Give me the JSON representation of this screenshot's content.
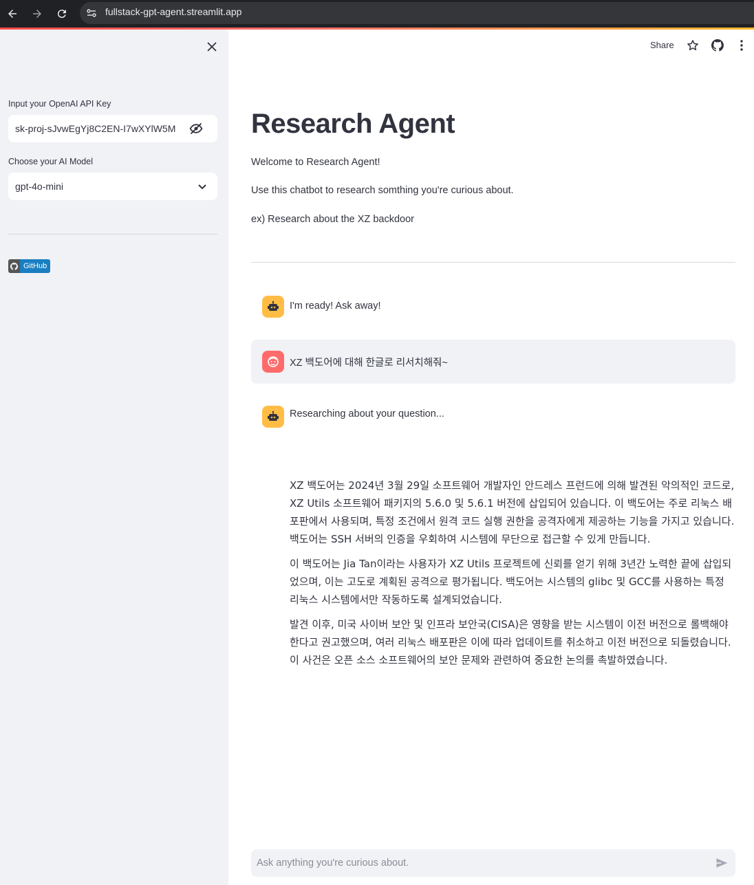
{
  "browser": {
    "url": "fullstack-gpt-agent.streamlit.app",
    "back_icon": "arrow-left-icon",
    "forward_icon": "arrow-right-icon",
    "reload_icon": "reload-icon"
  },
  "sidebar": {
    "api_key_label": "Input your OpenAI API Key",
    "api_key_value": "sk-proj-sJvwEgYj8C2EN-I7wXYlW5M",
    "model_label": "Choose your AI Model",
    "model_value": "gpt-4o-mini",
    "github_badge": "GitHub"
  },
  "toolbar": {
    "share_label": "Share"
  },
  "main": {
    "title": "Research Agent",
    "intro": [
      "Welcome to Research Agent!",
      "Use this chatbot to research somthing you're curious about.",
      "ex) Research about the XZ backdoor"
    ]
  },
  "chat": {
    "messages": [
      {
        "role": "assistant",
        "text": "I'm ready! Ask away!"
      },
      {
        "role": "user",
        "text": "XZ 백도어에 대해 한글로 리서치해줘~"
      },
      {
        "role": "assistant",
        "text": "Researching about your question..."
      }
    ],
    "answer_paragraphs": [
      "XZ 백도어는 2024년 3월 29일 소프트웨어 개발자인 안드레스 프런드에 의해 발견된 악의적인 코드로, XZ Utils 소프트웨어 패키지의 5.6.0 및 5.6.1 버전에 삽입되어 있습니다. 이 백도어는 주로 리눅스 배포판에서 사용되며, 특정 조건에서 원격 코드 실행 권한을 공격자에게 제공하는 기능을 가지고 있습니다. 백도어는 SSH 서버의 인증을 우회하여 시스템에 무단으로 접근할 수 있게 만듭니다.",
      "이 백도어는 Jia Tan이라는 사용자가 XZ Utils 프로젝트에 신뢰를 얻기 위해 3년간 노력한 끝에 삽입되었으며, 이는 고도로 계획된 공격으로 평가됩니다. 백도어는 시스템의 glibc 및 GCC를 사용하는 특정 리눅스 시스템에서만 작동하도록 설계되었습니다.",
      "발견 이후, 미국 사이버 보안 및 인프라 보안국(CISA)은 영향을 받는 시스템이 이전 버전으로 롤백해야 한다고 권고했으며, 여러 리눅스 배포판은 이에 따라 업데이트를 취소하고 이전 버전으로 되돌렸습니다. 이 사건은 오픈 소스 소프트웨어의 보안 문제와 관련하여 중요한 논의를 촉발하였습니다."
    ],
    "input_placeholder": "Ask anything you're curious about."
  },
  "colors": {
    "accent_red": "#ff4b4b",
    "bot_avatar": "#ffbd45",
    "user_avatar": "#ff6b6b",
    "sidebar_bg": "#f0f2f6"
  }
}
